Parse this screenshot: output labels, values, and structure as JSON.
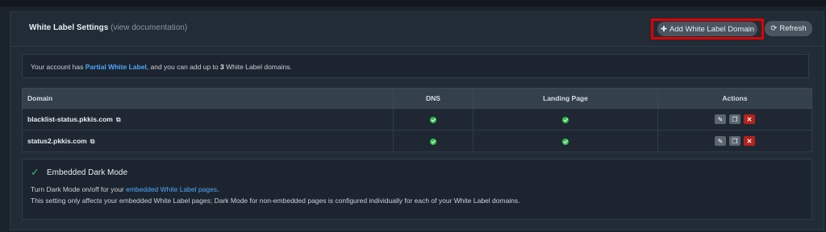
{
  "header": {
    "title": "White Label Settings",
    "doc_open": " (",
    "doc_link": "view documentation",
    "doc_close": ")",
    "add_button": "Add White Label Domain",
    "refresh_button": "Refresh"
  },
  "info": {
    "prefix": "Your account has ",
    "plan": "Partial White Label",
    "middle": ", and you can add up to ",
    "count": "3",
    "suffix": " White Label domains."
  },
  "table": {
    "columns": [
      "Domain",
      "DNS",
      "Landing Page",
      "Actions"
    ],
    "rows": [
      {
        "domain": "blacklist-status.pkkis.com"
      },
      {
        "domain": "status2.pkkis.com"
      }
    ]
  },
  "dark_mode": {
    "label": "Embedded Dark Mode",
    "line1_prefix": "Turn Dark Mode on/off for your ",
    "line1_link": "embedded White Label pages",
    "line1_suffix": ".",
    "line2": "This setting only affects your embedded White Label pages; Dark Mode for non-embedded pages is configured individually for each of your White Label domains."
  },
  "colors": {
    "accent": "#4ea7ff",
    "success": "#2fbf4a",
    "danger": "#b3231c",
    "highlight_box": "#e00000"
  }
}
